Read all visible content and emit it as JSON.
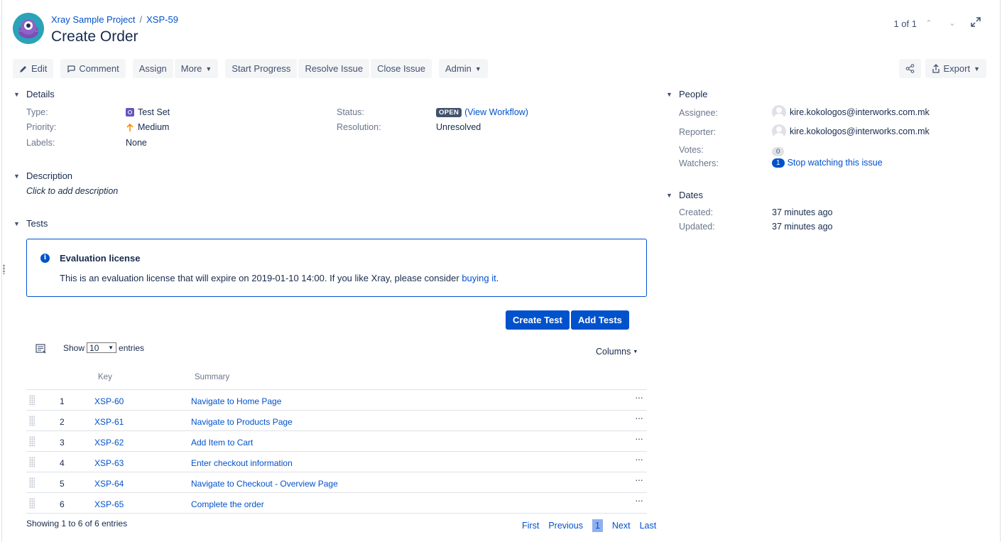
{
  "header": {
    "project": "Xray Sample Project",
    "issue_key": "XSP-59",
    "title": "Create Order",
    "pager": "1 of 1"
  },
  "toolbar": {
    "edit": "Edit",
    "comment": "Comment",
    "assign": "Assign",
    "more": "More",
    "start_progress": "Start Progress",
    "resolve": "Resolve Issue",
    "close": "Close Issue",
    "admin": "Admin",
    "export": "Export"
  },
  "details": {
    "heading": "Details",
    "type_label": "Type:",
    "type_value": "Test Set",
    "priority_label": "Priority:",
    "priority_value": "Medium",
    "labels_label": "Labels:",
    "labels_value": "None",
    "status_label": "Status:",
    "status_value": "OPEN",
    "workflow_link": "(View Workflow)",
    "resolution_label": "Resolution:",
    "resolution_value": "Unresolved"
  },
  "description": {
    "heading": "Description",
    "placeholder": "Click to add description"
  },
  "tests": {
    "heading": "Tests",
    "message_title": "Evaluation license",
    "message_body": "This is an evaluation license that will expire on 2019-01-10 14:00. If you like Xray, please consider ",
    "message_link": "buying it",
    "message_end": ".",
    "create_test": "Create Test",
    "add_tests": "Add Tests",
    "show": "Show",
    "entries_count": "10",
    "entries": "entries",
    "columns": "Columns",
    "col_key": "Key",
    "col_summary": "Summary",
    "rows": [
      {
        "num": "1",
        "key": "XSP-60",
        "summary": "Navigate to Home Page"
      },
      {
        "num": "2",
        "key": "XSP-61",
        "summary": "Navigate to Products Page"
      },
      {
        "num": "3",
        "key": "XSP-62",
        "summary": "Add Item to Cart"
      },
      {
        "num": "4",
        "key": "XSP-63",
        "summary": "Enter checkout information"
      },
      {
        "num": "5",
        "key": "XSP-64",
        "summary": "Navigate to Checkout - Overview Page"
      },
      {
        "num": "6",
        "key": "XSP-65",
        "summary": "Complete the order"
      }
    ],
    "showing": "Showing 1 to 6 of 6 entries",
    "first": "First",
    "previous": "Previous",
    "current_page": "1",
    "next": "Next",
    "last": "Last"
  },
  "people": {
    "heading": "People",
    "assignee_label": "Assignee:",
    "assignee_value": "kire.kokologos@interworks.com.mk",
    "reporter_label": "Reporter:",
    "reporter_value": "kire.kokologos@interworks.com.mk",
    "votes_label": "Votes:",
    "votes_value": "0",
    "watchers_label": "Watchers:",
    "watchers_value": "1",
    "watch_link": "Stop watching this issue"
  },
  "dates": {
    "heading": "Dates",
    "created_label": "Created:",
    "created_value": "37 minutes ago",
    "updated_label": "Updated:",
    "updated_value": "37 minutes ago"
  },
  "colors": {
    "primary": "#0052cc",
    "text": "#172b4d",
    "muted": "#6b778c",
    "button_bg": "#f4f5f7",
    "priority_medium": "#ff8b00"
  }
}
